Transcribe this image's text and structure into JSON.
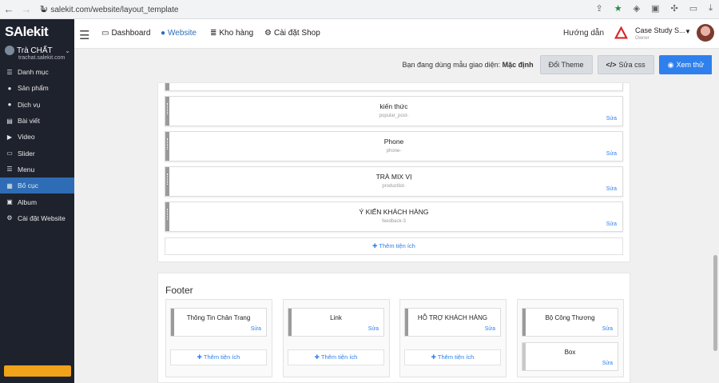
{
  "browser": {
    "url": "salekit.com/website/layout_template"
  },
  "sidebar": {
    "logo": "SAlekit",
    "store_name": "Trà CHẤT",
    "store_url": "trachat.salekit.com",
    "items": [
      {
        "label": "Danh mục",
        "icon": "list-icon",
        "glyph": "☰"
      },
      {
        "label": "Sản phẩm",
        "icon": "product-icon",
        "glyph": "●"
      },
      {
        "label": "Dịch vụ",
        "icon": "service-icon",
        "glyph": "●"
      },
      {
        "label": "Bài viết",
        "icon": "article-icon",
        "glyph": "▤"
      },
      {
        "label": "Video",
        "icon": "video-icon",
        "glyph": "▶"
      },
      {
        "label": "Slider",
        "icon": "slider-icon",
        "glyph": "▭"
      },
      {
        "label": "Menu",
        "icon": "menu-icon",
        "glyph": "☰"
      },
      {
        "label": "Bố cục",
        "icon": "layout-icon",
        "glyph": "▦",
        "active": true
      },
      {
        "label": "Album",
        "icon": "album-icon",
        "glyph": "▣"
      },
      {
        "label": "Cài đặt Website",
        "icon": "settings-icon",
        "glyph": "⚙"
      }
    ]
  },
  "topnav": {
    "items": [
      {
        "label": "Dashboard",
        "icon": "monitor-icon",
        "glyph": "▭"
      },
      {
        "label": "Website",
        "icon": "globe-icon",
        "glyph": "●",
        "active": true
      },
      {
        "label": "Kho hàng",
        "icon": "database-icon",
        "glyph": "≣"
      },
      {
        "label": "Cài đặt Shop",
        "icon": "gear-icon",
        "glyph": "⚙"
      }
    ],
    "help": "Hướng dẫn",
    "shop_name": "Case Study S...",
    "shop_role": "Owner",
    "colors": {
      "accent": "#2e6db5",
      "sidebar": "#1e222d"
    }
  },
  "action_bar": {
    "theme_label": "Bạn đang dùng mẫu giao diện:",
    "theme_name": "Mặc định",
    "change_theme": "Đổi Theme",
    "edit_css": "Sửa css",
    "preview": "Xem thử"
  },
  "layout": {
    "widgets": [
      {
        "title": "kiến thức",
        "sub": "popular_post-",
        "edit": "Sửa"
      },
      {
        "title": "Phone",
        "sub": "phone-",
        "edit": "Sửa"
      },
      {
        "title": "TRÀ MIX VỊ",
        "sub": "productlist-",
        "edit": "Sửa"
      },
      {
        "title": "Ý KIẾN KHÁCH HÀNG",
        "sub": "feedback-3",
        "edit": "Sửa"
      }
    ],
    "add_label": "Thêm tiện ích"
  },
  "footer": {
    "title": "Footer",
    "columns": [
      {
        "widgets": [
          {
            "title": "Thông Tin Chân Trang",
            "edit": "Sửa"
          }
        ],
        "add_label": "Thêm tiện ích"
      },
      {
        "widgets": [
          {
            "title": "Link",
            "edit": "Sửa"
          }
        ],
        "add_label": "Thêm tiện ích"
      },
      {
        "widgets": [
          {
            "title": "HỖ TRỢ KHÁCH HÀNG",
            "edit": "Sửa"
          }
        ],
        "add_label": "Thêm tiện ích"
      },
      {
        "widgets": [
          {
            "title": "Bộ Công Thương",
            "edit": "Sửa"
          },
          {
            "title": "Box",
            "edit": "Sửa"
          }
        ]
      }
    ]
  }
}
